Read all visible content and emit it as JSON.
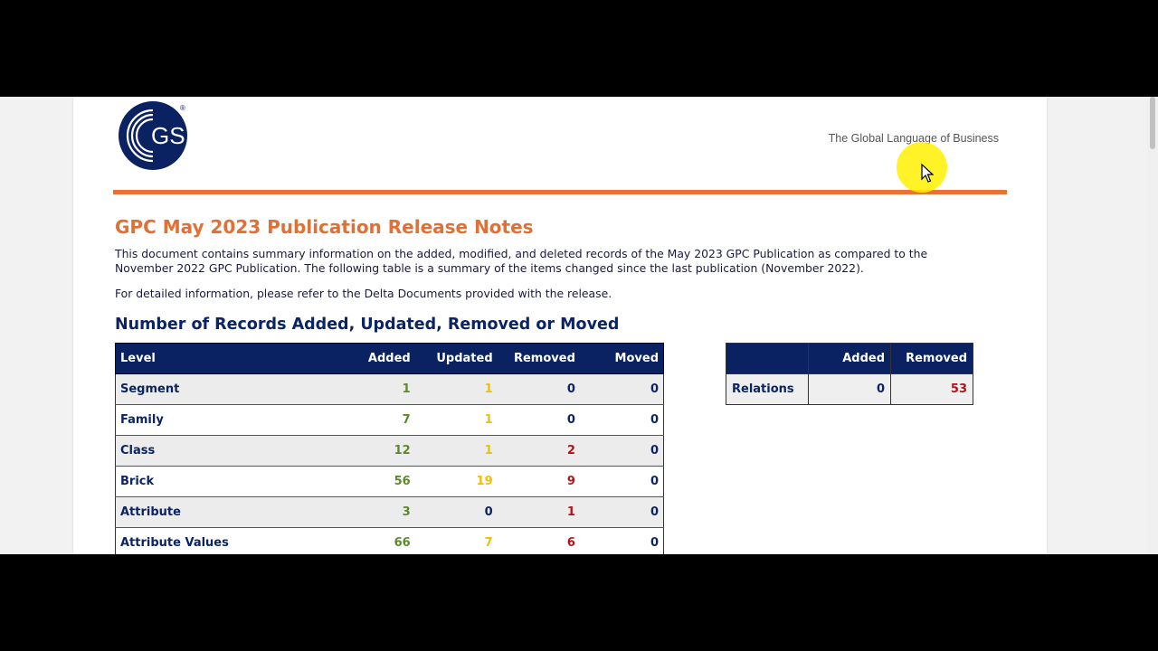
{
  "header": {
    "logo_text": "GS1",
    "logo_mark": "®",
    "tagline": "The Global Language of Business"
  },
  "document": {
    "title": "GPC May 2023 Publication Release Notes",
    "paragraph1_line1": "This document contains summary information on the added, modified, and deleted records of the May 2023 GPC Publication as compared to the",
    "paragraph1_line2": "November 2022 GPC Publication. The following table is a summary of the items changed since the last publication (November 2022).",
    "paragraph2": "For detailed information, please refer to the Delta Documents provided with the release.",
    "subtitle": "Number of Records Added, Updated, Removed or Moved"
  },
  "records_table": {
    "headers": [
      "Level",
      "Added",
      "Updated",
      "Removed",
      "Moved"
    ],
    "rows": [
      {
        "level": "Segment",
        "added": "1",
        "updated": "1",
        "removed": "0",
        "moved": "0"
      },
      {
        "level": "Family",
        "added": "7",
        "updated": "1",
        "removed": "0",
        "moved": "0"
      },
      {
        "level": "Class",
        "added": "12",
        "updated": "1",
        "removed": "2",
        "moved": "0"
      },
      {
        "level": "Brick",
        "added": "56",
        "updated": "19",
        "removed": "9",
        "moved": "0"
      },
      {
        "level": "Attribute",
        "added": "3",
        "updated": "0",
        "removed": "1",
        "moved": "0"
      },
      {
        "level": "Attribute Values",
        "added": "66",
        "updated": "7",
        "removed": "6",
        "moved": "0"
      }
    ]
  },
  "relations_table": {
    "headers": [
      "",
      "Added",
      "Removed"
    ],
    "row": {
      "level": "Relations",
      "added": "0",
      "removed": "53"
    }
  },
  "colors": {
    "accent_orange": "#e17037",
    "header_navy": "#0a2162",
    "added_green": "#5a8a2a",
    "updated_yellow": "#f0c000",
    "removed_red": "#b3141b"
  }
}
